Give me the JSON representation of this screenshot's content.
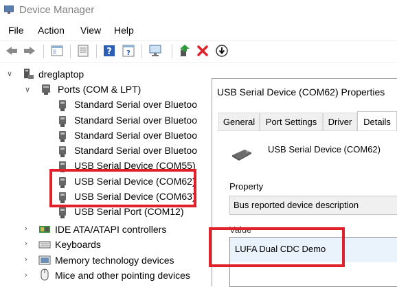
{
  "window": {
    "title": "Device Manager"
  },
  "menu": [
    "File",
    "Action",
    "View",
    "Help"
  ],
  "toolbar": {
    "icons": [
      "back-arrow-icon",
      "forward-arrow-icon",
      "show-hide-console-tree-icon",
      "properties-icon",
      "help-icon",
      "action-pane-icon",
      "scan-hardware-icon",
      "update-driver-icon",
      "uninstall-icon",
      "disable-device-icon"
    ]
  },
  "tree": {
    "root": "dreglaptop",
    "ports_category": "Ports (COM & LPT)",
    "ports": [
      "Standard Serial over Bluetoo",
      "Standard Serial over Bluetoo",
      "Standard Serial over Bluetoo",
      "Standard Serial over Bluetoo",
      "USB Serial Device (COM55)",
      "USB Serial Device (COM62)",
      "USB Serial Device (COM63)",
      "USB Serial Port (COM12)"
    ],
    "categories": [
      "IDE ATA/ATAPI controllers",
      "Keyboards",
      "Memory technology devices",
      "Mice and other pointing devices"
    ]
  },
  "dialog": {
    "title": "USB Serial Device (COM62) Properties",
    "tabs": [
      "General",
      "Port Settings",
      "Driver",
      "Details"
    ],
    "active_tab": "Details",
    "device_name": "USB Serial Device (COM62)",
    "property_label": "Property",
    "property_value": "Bus reported device description",
    "value_label": "Value",
    "value_text": "LUFA Dual CDC Demo"
  },
  "colors": {
    "highlight_box": "#e0202b",
    "selection_bg": "#eaf3fb",
    "delete_x": "#e0202b"
  }
}
